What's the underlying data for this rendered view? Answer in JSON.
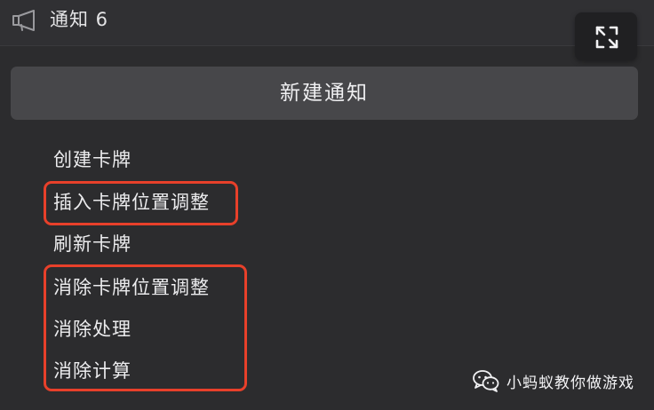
{
  "header": {
    "icon": "megaphone-icon",
    "title": "通知 6"
  },
  "new_notification_button": "新建通知",
  "notification_items": [
    "创建卡牌",
    "插入卡牌位置调整",
    "刷新卡牌",
    "消除卡牌位置调整",
    "消除处理",
    "消除计算"
  ],
  "highlight_color": "#e8402a",
  "watermark": {
    "icon": "wechat-icon",
    "text": "小蚂蚁教你做游戏"
  }
}
